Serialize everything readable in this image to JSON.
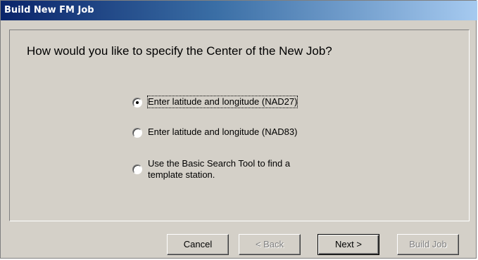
{
  "window": {
    "title": "Build New FM Job"
  },
  "main": {
    "question": "How would you like to specify the Center of the New Job?",
    "options": [
      {
        "label": "Enter latitude and longitude (NAD27)",
        "selected": true
      },
      {
        "label": "Enter latitude and longitude (NAD83)",
        "selected": false
      },
      {
        "label_line1": "Use the Basic Search Tool to find a",
        "label_line2": "template station.",
        "selected": false
      }
    ]
  },
  "buttons": {
    "cancel": "Cancel",
    "back": "< Back",
    "next": "Next >",
    "build_job": "Build Job"
  },
  "colors": {
    "title_start": "#0a246a",
    "title_end": "#a6caf0",
    "face": "#d4d0c8"
  }
}
